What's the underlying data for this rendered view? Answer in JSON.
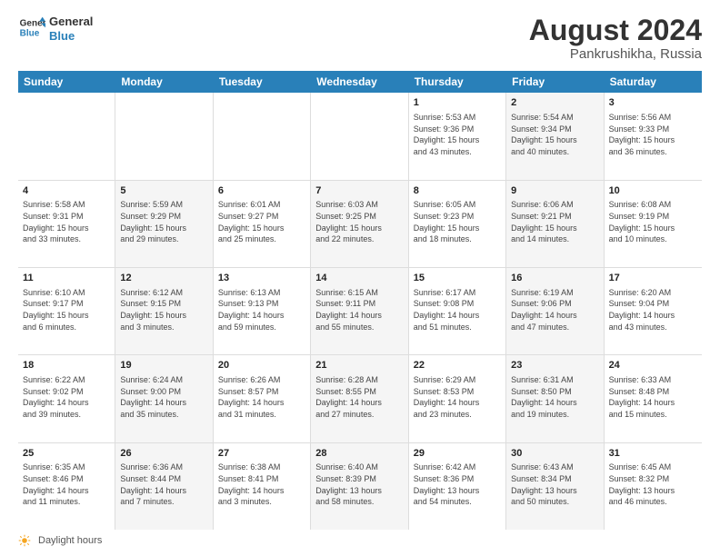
{
  "header": {
    "logo_line1": "General",
    "logo_line2": "Blue",
    "month_year": "August 2024",
    "location": "Pankrushikha, Russia"
  },
  "weekdays": [
    "Sunday",
    "Monday",
    "Tuesday",
    "Wednesday",
    "Thursday",
    "Friday",
    "Saturday"
  ],
  "weeks": [
    [
      {
        "day": "",
        "info": "",
        "shaded": false
      },
      {
        "day": "",
        "info": "",
        "shaded": false
      },
      {
        "day": "",
        "info": "",
        "shaded": false
      },
      {
        "day": "",
        "info": "",
        "shaded": false
      },
      {
        "day": "1",
        "info": "Sunrise: 5:53 AM\nSunset: 9:36 PM\nDaylight: 15 hours\nand 43 minutes.",
        "shaded": false
      },
      {
        "day": "2",
        "info": "Sunrise: 5:54 AM\nSunset: 9:34 PM\nDaylight: 15 hours\nand 40 minutes.",
        "shaded": true
      },
      {
        "day": "3",
        "info": "Sunrise: 5:56 AM\nSunset: 9:33 PM\nDaylight: 15 hours\nand 36 minutes.",
        "shaded": false
      }
    ],
    [
      {
        "day": "4",
        "info": "Sunrise: 5:58 AM\nSunset: 9:31 PM\nDaylight: 15 hours\nand 33 minutes.",
        "shaded": false
      },
      {
        "day": "5",
        "info": "Sunrise: 5:59 AM\nSunset: 9:29 PM\nDaylight: 15 hours\nand 29 minutes.",
        "shaded": true
      },
      {
        "day": "6",
        "info": "Sunrise: 6:01 AM\nSunset: 9:27 PM\nDaylight: 15 hours\nand 25 minutes.",
        "shaded": false
      },
      {
        "day": "7",
        "info": "Sunrise: 6:03 AM\nSunset: 9:25 PM\nDaylight: 15 hours\nand 22 minutes.",
        "shaded": true
      },
      {
        "day": "8",
        "info": "Sunrise: 6:05 AM\nSunset: 9:23 PM\nDaylight: 15 hours\nand 18 minutes.",
        "shaded": false
      },
      {
        "day": "9",
        "info": "Sunrise: 6:06 AM\nSunset: 9:21 PM\nDaylight: 15 hours\nand 14 minutes.",
        "shaded": true
      },
      {
        "day": "10",
        "info": "Sunrise: 6:08 AM\nSunset: 9:19 PM\nDaylight: 15 hours\nand 10 minutes.",
        "shaded": false
      }
    ],
    [
      {
        "day": "11",
        "info": "Sunrise: 6:10 AM\nSunset: 9:17 PM\nDaylight: 15 hours\nand 6 minutes.",
        "shaded": false
      },
      {
        "day": "12",
        "info": "Sunrise: 6:12 AM\nSunset: 9:15 PM\nDaylight: 15 hours\nand 3 minutes.",
        "shaded": true
      },
      {
        "day": "13",
        "info": "Sunrise: 6:13 AM\nSunset: 9:13 PM\nDaylight: 14 hours\nand 59 minutes.",
        "shaded": false
      },
      {
        "day": "14",
        "info": "Sunrise: 6:15 AM\nSunset: 9:11 PM\nDaylight: 14 hours\nand 55 minutes.",
        "shaded": true
      },
      {
        "day": "15",
        "info": "Sunrise: 6:17 AM\nSunset: 9:08 PM\nDaylight: 14 hours\nand 51 minutes.",
        "shaded": false
      },
      {
        "day": "16",
        "info": "Sunrise: 6:19 AM\nSunset: 9:06 PM\nDaylight: 14 hours\nand 47 minutes.",
        "shaded": true
      },
      {
        "day": "17",
        "info": "Sunrise: 6:20 AM\nSunset: 9:04 PM\nDaylight: 14 hours\nand 43 minutes.",
        "shaded": false
      }
    ],
    [
      {
        "day": "18",
        "info": "Sunrise: 6:22 AM\nSunset: 9:02 PM\nDaylight: 14 hours\nand 39 minutes.",
        "shaded": false
      },
      {
        "day": "19",
        "info": "Sunrise: 6:24 AM\nSunset: 9:00 PM\nDaylight: 14 hours\nand 35 minutes.",
        "shaded": true
      },
      {
        "day": "20",
        "info": "Sunrise: 6:26 AM\nSunset: 8:57 PM\nDaylight: 14 hours\nand 31 minutes.",
        "shaded": false
      },
      {
        "day": "21",
        "info": "Sunrise: 6:28 AM\nSunset: 8:55 PM\nDaylight: 14 hours\nand 27 minutes.",
        "shaded": true
      },
      {
        "day": "22",
        "info": "Sunrise: 6:29 AM\nSunset: 8:53 PM\nDaylight: 14 hours\nand 23 minutes.",
        "shaded": false
      },
      {
        "day": "23",
        "info": "Sunrise: 6:31 AM\nSunset: 8:50 PM\nDaylight: 14 hours\nand 19 minutes.",
        "shaded": true
      },
      {
        "day": "24",
        "info": "Sunrise: 6:33 AM\nSunset: 8:48 PM\nDaylight: 14 hours\nand 15 minutes.",
        "shaded": false
      }
    ],
    [
      {
        "day": "25",
        "info": "Sunrise: 6:35 AM\nSunset: 8:46 PM\nDaylight: 14 hours\nand 11 minutes.",
        "shaded": false
      },
      {
        "day": "26",
        "info": "Sunrise: 6:36 AM\nSunset: 8:44 PM\nDaylight: 14 hours\nand 7 minutes.",
        "shaded": true
      },
      {
        "day": "27",
        "info": "Sunrise: 6:38 AM\nSunset: 8:41 PM\nDaylight: 14 hours\nand 3 minutes.",
        "shaded": false
      },
      {
        "day": "28",
        "info": "Sunrise: 6:40 AM\nSunset: 8:39 PM\nDaylight: 13 hours\nand 58 minutes.",
        "shaded": true
      },
      {
        "day": "29",
        "info": "Sunrise: 6:42 AM\nSunset: 8:36 PM\nDaylight: 13 hours\nand 54 minutes.",
        "shaded": false
      },
      {
        "day": "30",
        "info": "Sunrise: 6:43 AM\nSunset: 8:34 PM\nDaylight: 13 hours\nand 50 minutes.",
        "shaded": true
      },
      {
        "day": "31",
        "info": "Sunrise: 6:45 AM\nSunset: 8:32 PM\nDaylight: 13 hours\nand 46 minutes.",
        "shaded": false
      }
    ]
  ],
  "footer": {
    "daylight_label": "Daylight hours"
  }
}
